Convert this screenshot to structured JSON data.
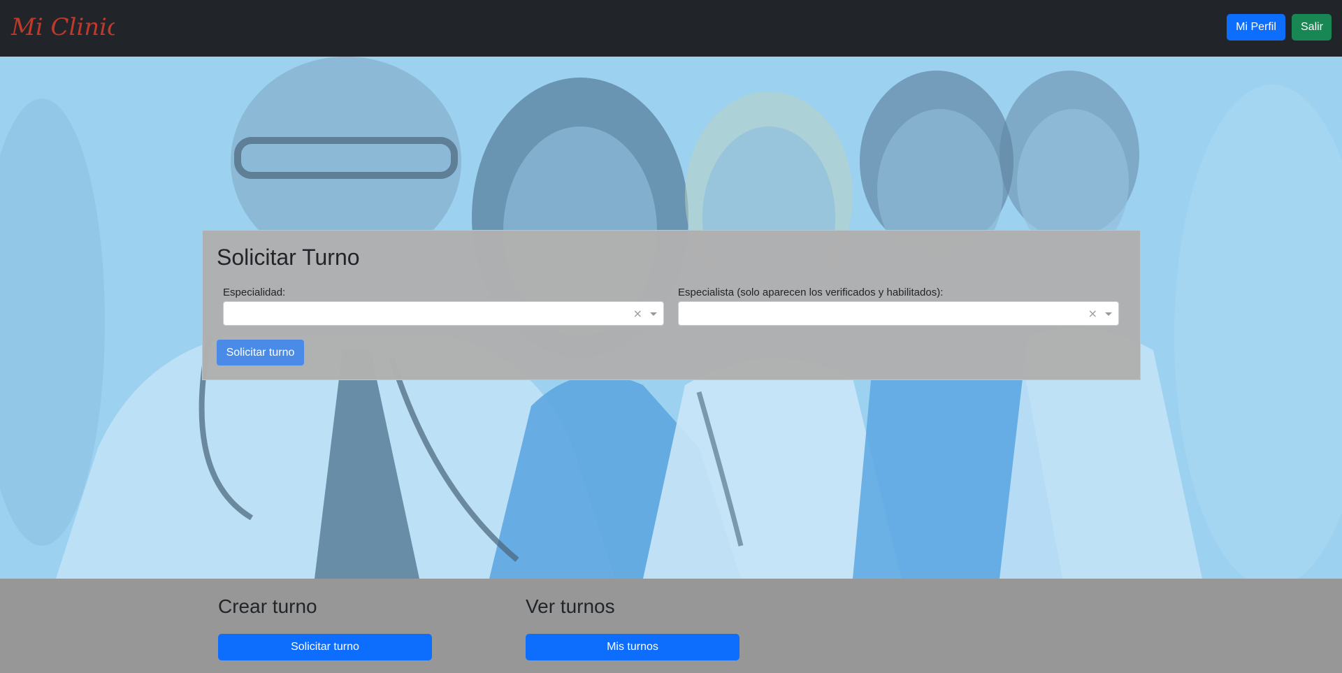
{
  "navbar": {
    "logo_text": "Mi Clinica",
    "mi_perfil_label": "Mi Perfil",
    "salir_label": "Salir"
  },
  "form": {
    "title": "Solicitar Turno",
    "especialidad_label": "Especialidad:",
    "especialidad_value": "",
    "especialista_label": "Especialista (solo aparecen los verificados y habilitados):",
    "especialista_value": "",
    "clear_symbol": "×",
    "submit_label": "Solicitar turno"
  },
  "sections": [
    {
      "title": "Crear turno",
      "button_label": "Solicitar turno"
    },
    {
      "title": "Ver turnos",
      "button_label": "Mis turnos"
    }
  ],
  "colors": {
    "navbar_bg": "#212529",
    "primary": "#0d6efd",
    "success": "#198754",
    "logo_red": "#c0392b",
    "card_bg": "#afafaf",
    "bottom_bg": "#979797"
  },
  "icons": {
    "clear": "close-icon",
    "dropdown": "chevron-down-icon"
  }
}
